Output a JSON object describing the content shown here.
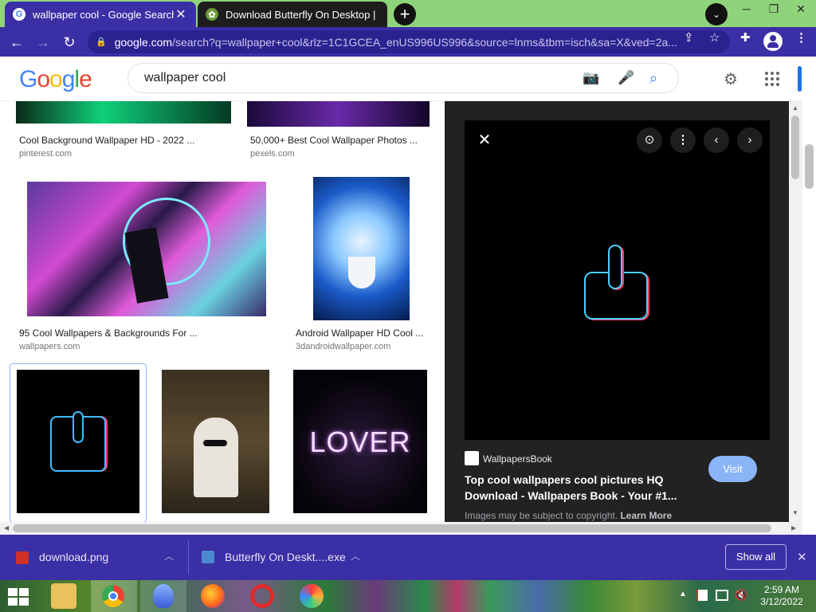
{
  "browser": {
    "tabs": [
      {
        "title": "wallpaper cool - Google Search",
        "favicon": "google-favicon",
        "active": true
      },
      {
        "title": "Download Butterfly On Desktop |",
        "favicon": "butterfly-favicon",
        "active": false
      }
    ],
    "new_tab_icon": "plus-icon",
    "url_host": "google.com",
    "url_rest": "/search?q=wallpaper+cool&rlz=1C1GCEA_enUS996US996&source=lnms&tbm=isch&sa=X&ved=2a..."
  },
  "google": {
    "logo": "Google",
    "query": "wallpaper cool"
  },
  "results": [
    {
      "title": "Cool Background Wallpaper HD - 2022 ...",
      "source": "pinterest.com"
    },
    {
      "title": "50,000+ Best Cool Wallpaper Photos ...",
      "source": "pexels.com"
    },
    {
      "title": "95 Cool Wallpapers & Backgrounds For ...",
      "source": "wallpapers.com"
    },
    {
      "title": "Android Wallpaper HD Cool ...",
      "source": "3dandroidwallpaper.com"
    }
  ],
  "lover_text": "LOVER",
  "preview": {
    "site": "WallpapersBook",
    "title_line1": "Top cool wallpapers cool pictures HQ",
    "title_line2": "Download - Wallpapers Book - Your #1...",
    "visit_label": "Visit",
    "copyright": "Images may be subject to copyright.",
    "learn_more": "Learn More"
  },
  "downloads": {
    "items": [
      {
        "name": "download.png"
      },
      {
        "name": "Butterfly On Deskt....exe"
      }
    ],
    "show_all_label": "Show all"
  },
  "taskbar": {
    "time": "2:59 AM",
    "date": "3/12/2022"
  },
  "colors": {
    "tab_strip": "#8fd47a",
    "browser_accent": "#3a2fa5",
    "visit_button": "#8ab4f8"
  }
}
